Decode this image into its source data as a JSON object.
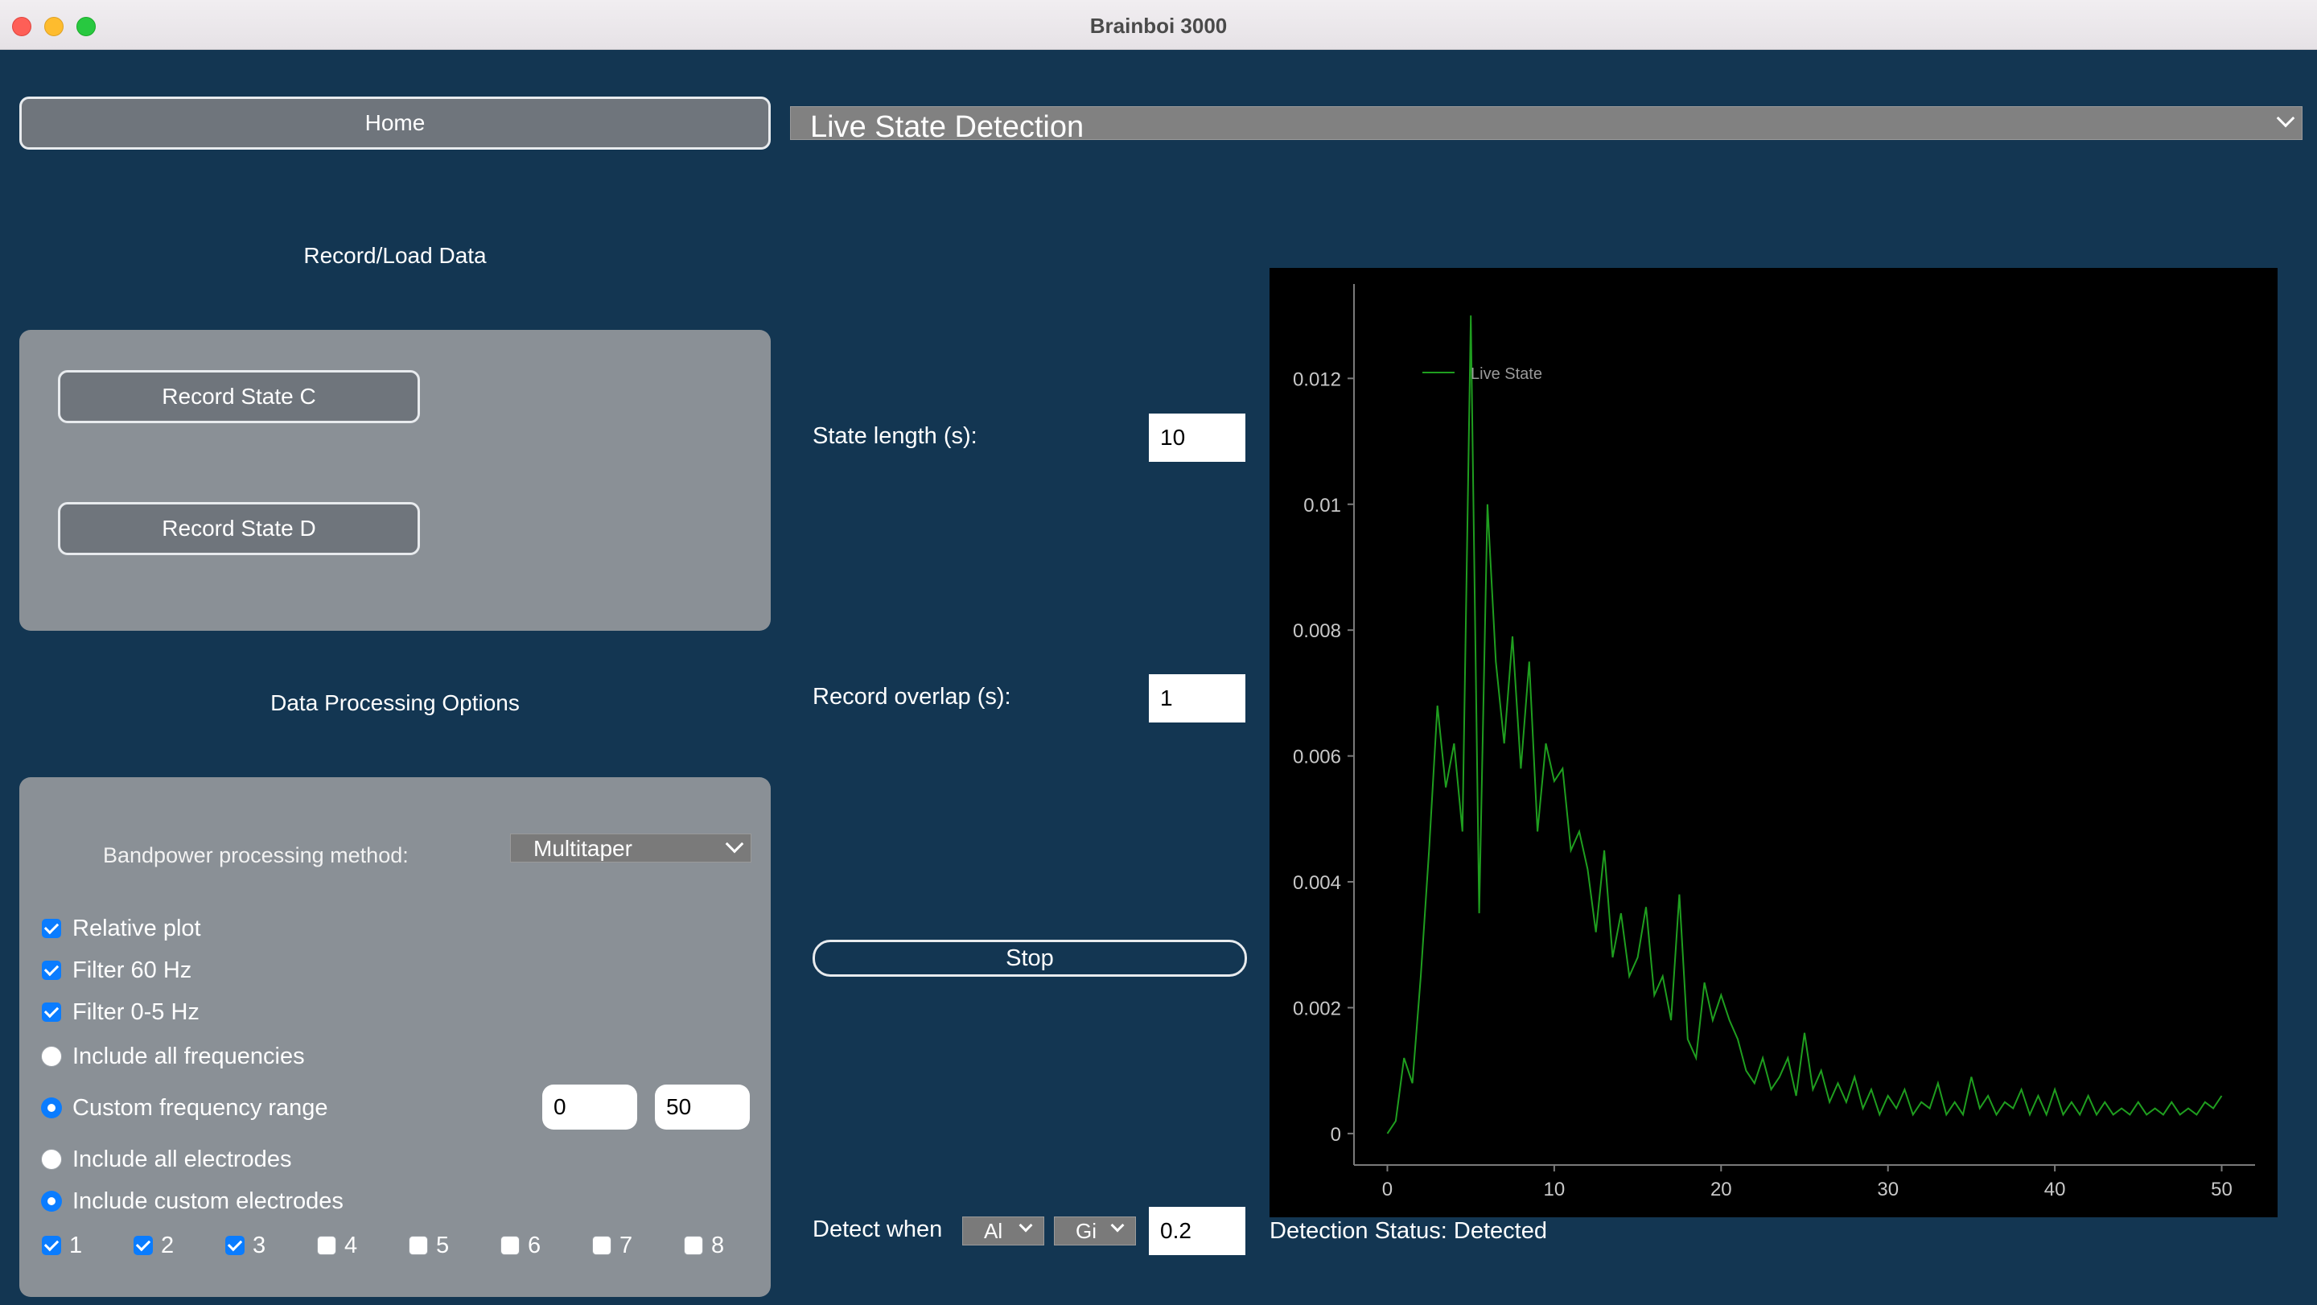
{
  "window": {
    "title": "Brainboi 3000"
  },
  "left": {
    "home_label": "Home",
    "record_section_title": "Record/Load Data",
    "record_buttons": [
      "Record State C",
      "Record State D"
    ],
    "processing_section_title": "Data Processing Options",
    "bandpower_label": "Bandpower processing method:",
    "bandpower_value": "Multitaper",
    "options": [
      {
        "label": "Relative plot",
        "kind": "checkbox",
        "checked": true
      },
      {
        "label": "Filter 60 Hz",
        "kind": "checkbox",
        "checked": true
      },
      {
        "label": "Filter 0-5 Hz",
        "kind": "checkbox",
        "checked": true
      },
      {
        "label": "Include all frequencies",
        "kind": "radio",
        "checked": false
      },
      {
        "label": "Custom frequency range",
        "kind": "radio",
        "checked": true
      },
      {
        "label": "Include all electrodes",
        "kind": "radio",
        "checked": false
      },
      {
        "label": "Include custom electrodes",
        "kind": "radio",
        "checked": true
      }
    ],
    "freq_min": "0",
    "freq_max": "50",
    "electrodes": [
      {
        "label": "1",
        "checked": true
      },
      {
        "label": "2",
        "checked": true
      },
      {
        "label": "3",
        "checked": true
      },
      {
        "label": "4",
        "checked": false
      },
      {
        "label": "5",
        "checked": false
      },
      {
        "label": "6",
        "checked": false
      },
      {
        "label": "7",
        "checked": false
      },
      {
        "label": "8",
        "checked": false
      }
    ]
  },
  "main": {
    "mode_select": "Live State Detection",
    "state_length_label": "State length (s):",
    "state_length_value": "10",
    "record_overlap_label": "Record overlap (s):",
    "record_overlap_value": "1",
    "stop_label": "Stop",
    "detect_when_label": "Detect when",
    "detect_select_1": "Al",
    "detect_select_2": "Gi",
    "detect_threshold": "0.2",
    "detection_status": "Detection Status: Detected"
  },
  "chart_data": {
    "type": "line",
    "title": "",
    "xlabel": "",
    "ylabel": "",
    "xlim": [
      -2,
      52
    ],
    "ylim": [
      -0.0005,
      0.0135
    ],
    "xticks": [
      0,
      10,
      20,
      30,
      40,
      50
    ],
    "yticks": [
      "0",
      "0.002",
      "0.004",
      "0.006",
      "0.008",
      "0.01",
      "0.012"
    ],
    "ytick_values": [
      0,
      0.002,
      0.004,
      0.006,
      0.008,
      0.01,
      0.012
    ],
    "grid": false,
    "legend_position": "top-left",
    "series": [
      {
        "name": "Live State",
        "color": "#1f9e1f",
        "x": [
          0,
          0.5,
          1,
          1.5,
          2,
          2.5,
          3,
          3.5,
          4,
          4.5,
          5,
          5.5,
          6,
          6.5,
          7,
          7.5,
          8,
          8.5,
          9,
          9.5,
          10,
          10.5,
          11,
          11.5,
          12,
          12.5,
          13,
          13.5,
          14,
          14.5,
          15,
          15.5,
          16,
          16.5,
          17,
          17.5,
          18,
          18.5,
          19,
          19.5,
          20,
          20.5,
          21,
          21.5,
          22,
          22.5,
          23,
          23.5,
          24,
          24.5,
          25,
          25.5,
          26,
          26.5,
          27,
          27.5,
          28,
          28.5,
          29,
          29.5,
          30,
          30.5,
          31,
          31.5,
          32,
          32.5,
          33,
          33.5,
          34,
          34.5,
          35,
          35.5,
          36,
          36.5,
          37,
          37.5,
          38,
          38.5,
          39,
          39.5,
          40,
          40.5,
          41,
          41.5,
          42,
          42.5,
          43,
          43.5,
          44,
          44.5,
          45,
          45.5,
          46,
          46.5,
          47,
          47.5,
          48,
          48.5,
          49,
          49.5,
          50
        ],
        "y": [
          0,
          0.0002,
          0.0012,
          0.0008,
          0.0025,
          0.0045,
          0.0068,
          0.0055,
          0.0062,
          0.0048,
          0.013,
          0.0035,
          0.01,
          0.0075,
          0.0062,
          0.0079,
          0.0058,
          0.0075,
          0.0048,
          0.0062,
          0.0056,
          0.0058,
          0.0045,
          0.0048,
          0.0042,
          0.0032,
          0.0045,
          0.0028,
          0.0035,
          0.0025,
          0.0028,
          0.0036,
          0.0022,
          0.0025,
          0.0018,
          0.0038,
          0.0015,
          0.0012,
          0.0024,
          0.0018,
          0.0022,
          0.0018,
          0.0015,
          0.001,
          0.0008,
          0.0012,
          0.0007,
          0.0009,
          0.0012,
          0.0006,
          0.0016,
          0.0007,
          0.001,
          0.0005,
          0.0008,
          0.0005,
          0.0009,
          0.0004,
          0.0007,
          0.0003,
          0.0006,
          0.0004,
          0.0007,
          0.0003,
          0.0005,
          0.0004,
          0.0008,
          0.0003,
          0.0005,
          0.0003,
          0.0009,
          0.0004,
          0.0006,
          0.0003,
          0.0005,
          0.0004,
          0.0007,
          0.0003,
          0.0006,
          0.0003,
          0.0007,
          0.0003,
          0.0005,
          0.0003,
          0.0006,
          0.0003,
          0.0005,
          0.0003,
          0.0004,
          0.0003,
          0.0005,
          0.0003,
          0.0004,
          0.0003,
          0.0005,
          0.0003,
          0.0004,
          0.0003,
          0.0005,
          0.0004,
          0.0006
        ]
      }
    ]
  }
}
